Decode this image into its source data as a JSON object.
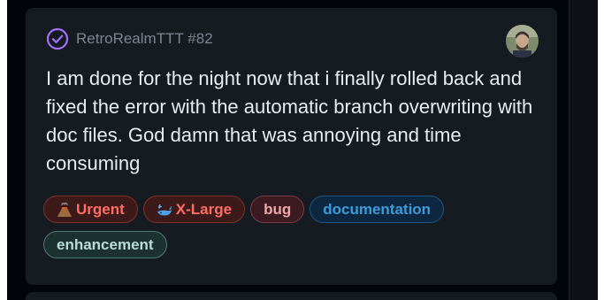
{
  "card": {
    "repository": "RetroRealmTTT",
    "issue_number": "#82",
    "status_icon": "issue-open-icon",
    "avatar_icon": "user-avatar-icon",
    "title": "I am done for the night now that i finally rolled back and fixed the error with the automatic branch overwriting with doc files. God damn that was annoying and time consuming",
    "labels": [
      {
        "emoji": "volcano-icon",
        "text": "Urgent",
        "color": "#ff6d63"
      },
      {
        "emoji": "whale-icon",
        "text": "X-Large",
        "color": "#ff6d63"
      },
      {
        "text": "bug",
        "color": "#f2a6a4"
      },
      {
        "text": "documentation",
        "color": "#3d9bd8"
      },
      {
        "text": "enhancement",
        "color": "#b9dbd9"
      }
    ]
  },
  "colors": {
    "background": "#010409",
    "card_background": "#161b22",
    "title_text": "#e6edf3",
    "muted_text": "#7d8590",
    "open_status": "#a371f7"
  }
}
